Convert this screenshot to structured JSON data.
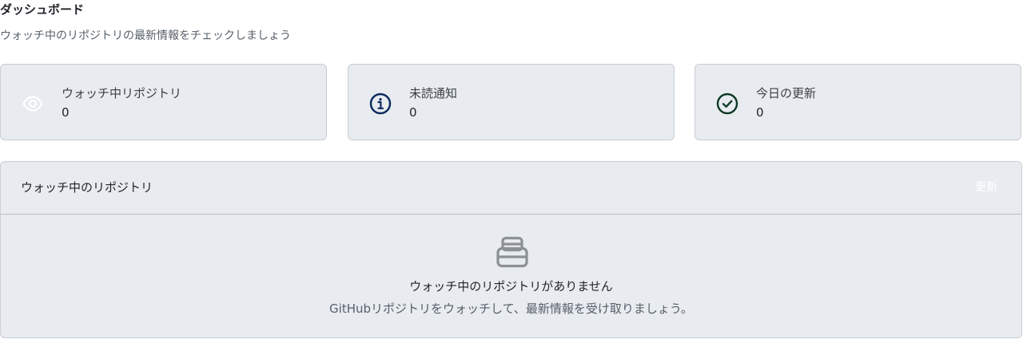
{
  "header": {
    "title": "ダッシュボード",
    "subtitle": "ウォッチ中のリポジトリの最新情報をチェックしましょう"
  },
  "stats": [
    {
      "label": "ウォッチ中リポジトリ",
      "value": "0",
      "icon": "eye-icon",
      "icon_color": "#ffffff"
    },
    {
      "label": "未読通知",
      "value": "0",
      "icon": "info-icon",
      "icon_color": "#0b2a5c"
    },
    {
      "label": "今日の更新",
      "value": "0",
      "icon": "check-circle-icon",
      "icon_color": "#0e3b26"
    }
  ],
  "repos": {
    "title": "ウォッチ中のリポジトリ",
    "refresh_label": "更新",
    "empty_icon": "inbox-icon",
    "empty_title": "ウォッチ中のリポジトリがありません",
    "empty_description": "GitHubリポジトリをウォッチして、最新情報を受け取りましょう。"
  },
  "colors": {
    "card_background": "#e8ebef",
    "card_border": "#c9ced5",
    "empty_icon": "#8c9097"
  }
}
